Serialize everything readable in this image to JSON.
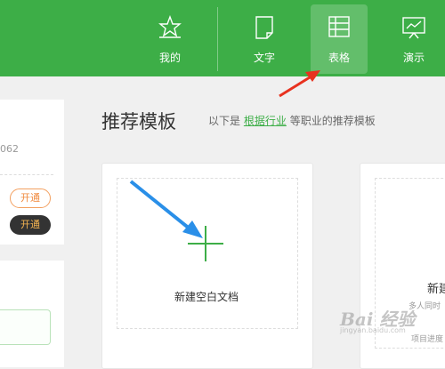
{
  "nav": {
    "items": [
      {
        "label": "我的",
        "icon": "star-icon"
      },
      {
        "label": "文字",
        "icon": "document-icon"
      },
      {
        "label": "表格",
        "icon": "spreadsheet-icon",
        "active": true
      },
      {
        "label": "演示",
        "icon": "presentation-icon"
      }
    ]
  },
  "sidebar": {
    "number_fragment": "062",
    "open_button_1": "开通",
    "open_button_2": "开通"
  },
  "templates": {
    "title": "推荐模板",
    "subtitle_prefix": "以下是",
    "subtitle_link": "根据行业",
    "subtitle_suffix": "等职业的推荐模板",
    "new_blank": "新建空白文档",
    "card2_title": "新建",
    "card2_sub": "多人同时",
    "card2_sub2": "项目进度"
  },
  "watermark": {
    "text": "Bai 经验",
    "url": "jingyan.baidu.com"
  },
  "colors": {
    "brand_green": "#3dae47",
    "annotation_red": "#e8321f",
    "annotation_blue": "#2a8fe8"
  }
}
